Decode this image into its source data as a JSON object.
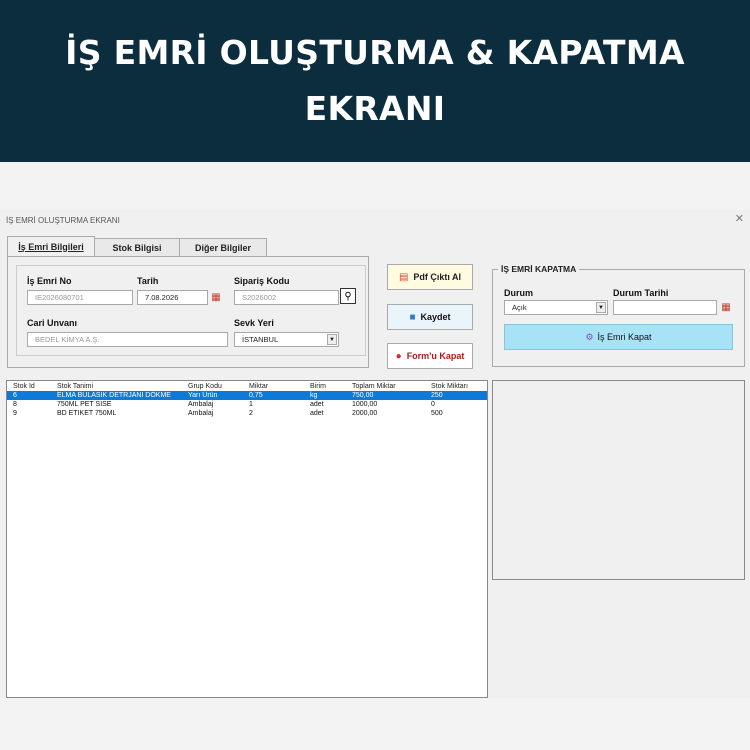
{
  "banner": {
    "title": "İŞ EMRİ OLUŞTURMA & KAPATMA EKRANI"
  },
  "window": {
    "title": "İŞ EMRİ OLUŞTURMA EKRANI",
    "close": "✕"
  },
  "tabs": [
    {
      "label": "İş Emri Bilgileri",
      "active": true
    },
    {
      "label": "Stok Bilgisi",
      "active": false
    },
    {
      "label": "Diğer Bilgiler",
      "active": false
    }
  ],
  "form": {
    "is_emri_no": {
      "label": "İş Emri No",
      "value": "IE2026080701"
    },
    "tarih": {
      "label": "Tarih",
      "value": "7.08.2026"
    },
    "siparis_kodu": {
      "label": "Sipariş Kodu",
      "value": "S2026002"
    },
    "cari_unvani": {
      "label": "Cari Unvanı",
      "value": "BEDEL KİMYA A.Ş."
    },
    "sevk_yeri": {
      "label": "Sevk Yeri",
      "value": "İSTANBUL"
    }
  },
  "buttons": {
    "pdf": "Pdf Çıktı Al",
    "save": "Kaydet",
    "close_form": "Form'u Kapat"
  },
  "closing": {
    "title": "İŞ EMRİ KAPATMA",
    "durum_label": "Durum",
    "durum_value": "Açık",
    "durum_tarihi_label": "Durum Tarihi",
    "durum_tarihi_value": "",
    "close_button": "İş Emri Kapat"
  },
  "list": {
    "headers": [
      "Stok Id",
      "Stok Tanimi",
      "Grup Kodu",
      "Miktar",
      "Birim",
      "Toplam Miktar",
      "Stok Miktarı"
    ],
    "rows": [
      [
        "6",
        "ELMA BULASIK DETRJANI DÖKME",
        "Yarı Ürün",
        "0,75",
        "kg",
        "750,00",
        "250"
      ],
      [
        "8",
        "750ML PET SISE",
        "Ambalaj",
        "1",
        "adet",
        "1000,00",
        "0"
      ],
      [
        "9",
        "BD ETIKET 750ML",
        "Ambalaj",
        "2",
        "adet",
        "2000,00",
        "500"
      ]
    ],
    "selected_index": 0
  },
  "colors": {
    "banner_bg": "#0b2d3e",
    "selection": "#0e7ad7",
    "close_button_bg": "#a8e2f6"
  }
}
